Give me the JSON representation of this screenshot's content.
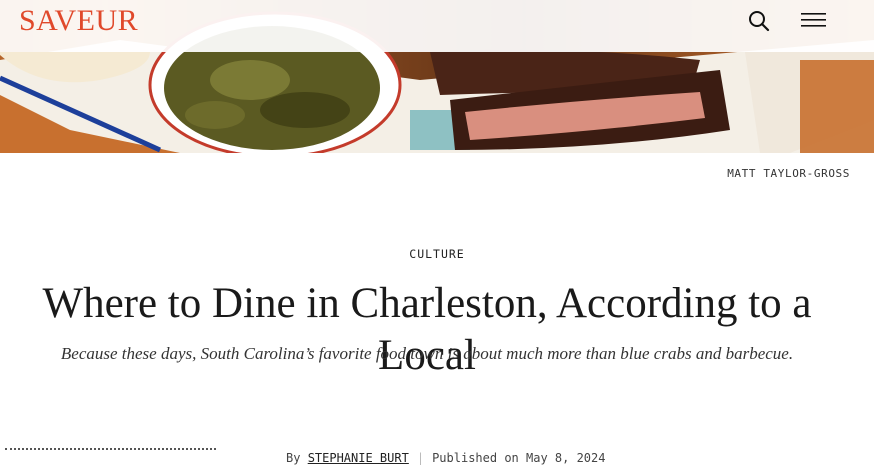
{
  "header": {
    "logo": "SAVEUR",
    "search_icon": "search-icon",
    "menu_icon": "hamburger-menu-icon"
  },
  "hero": {
    "photo_credit": "MATT TAYLOR-GROSS"
  },
  "article": {
    "category": "CULTURE",
    "title": "Where to Dine in Charleston, According to a Local",
    "dek": "Because these days, South Carolina’s favorite food town is about much more than blue crabs and barbecue.",
    "byline_prefix": "By",
    "author": "STEPHANIE BURT",
    "published": "Published on May 8, 2024"
  },
  "colors": {
    "brand": "#e0492b",
    "text": "#1a1a1a"
  }
}
